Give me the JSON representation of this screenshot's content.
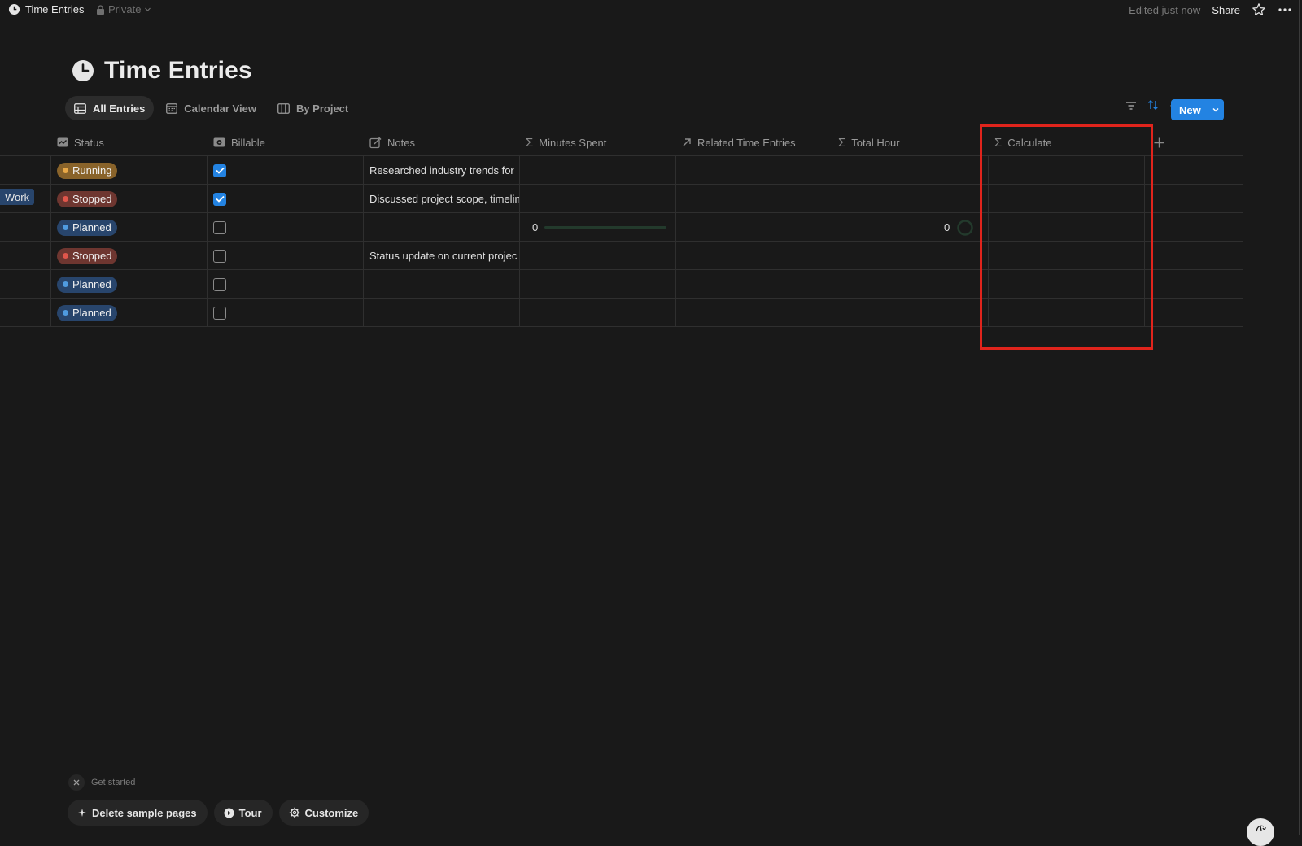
{
  "topbar": {
    "page_title": "Time Entries",
    "privacy": "Private",
    "edited": "Edited just now",
    "share": "Share"
  },
  "page": {
    "title": "Time Entries",
    "icon": "clock-icon"
  },
  "tabs": [
    {
      "label": "All Entries",
      "icon": "table-icon",
      "active": true
    },
    {
      "label": "Calendar View",
      "icon": "calendar-icon",
      "active": false
    },
    {
      "label": "By Project",
      "icon": "board-icon",
      "active": false
    }
  ],
  "toolbar": {
    "new_label": "New",
    "accent": "#2383e2"
  },
  "columns": [
    {
      "label": "Status",
      "icon": "status-icon"
    },
    {
      "label": "Billable",
      "icon": "checkbox-icon"
    },
    {
      "label": "Notes",
      "icon": "edit-icon"
    },
    {
      "label": "Minutes Spent",
      "icon": "sigma-icon"
    },
    {
      "label": "Related Time Entries",
      "icon": "arrow-up-right-icon"
    },
    {
      "label": "Total Hour",
      "icon": "sigma-icon"
    },
    {
      "label": "Calculate",
      "icon": "sigma-icon"
    }
  ],
  "rows": [
    {
      "status": "Running",
      "status_type": "running",
      "billable": true,
      "notes": "Researched industry trends for",
      "minutes": "",
      "total": ""
    },
    {
      "status": "Stopped",
      "status_type": "stopped",
      "billable": true,
      "notes": "Discussed project scope, timelin",
      "minutes": "",
      "total": ""
    },
    {
      "status": "Planned",
      "status_type": "planned",
      "billable": false,
      "notes": "",
      "minutes": "0",
      "total": "0"
    },
    {
      "status": "Stopped",
      "status_type": "stopped",
      "billable": false,
      "notes": "Status update on current projec",
      "minutes": "",
      "total": ""
    },
    {
      "status": "Planned",
      "status_type": "planned",
      "billable": false,
      "notes": "",
      "minutes": "",
      "total": ""
    },
    {
      "status": "Planned",
      "status_type": "planned",
      "billable": false,
      "notes": "",
      "minutes": "",
      "total": ""
    }
  ],
  "left_tag": "Work",
  "bottom": {
    "get_started": "Get started",
    "delete_sample": "Delete sample pages",
    "tour": "Tour",
    "customize": "Customize"
  },
  "colors": {
    "background": "#191919",
    "highlight": "#e0241c"
  }
}
